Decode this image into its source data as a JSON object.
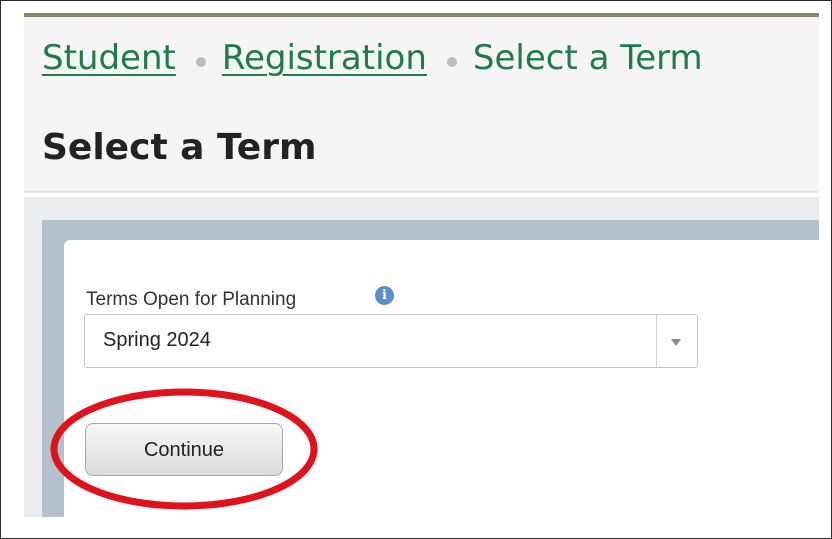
{
  "breadcrumb": {
    "items": [
      {
        "label": "Student"
      },
      {
        "label": "Registration"
      }
    ],
    "current": "Select a Term"
  },
  "page": {
    "title": "Select a Term"
  },
  "term_select": {
    "label": "Terms Open for Planning",
    "selected_value": "Spring 2024",
    "info_icon": "info-icon"
  },
  "actions": {
    "continue_label": "Continue"
  },
  "colors": {
    "link_green": "#1f7a4c",
    "annotation_red": "#e0121b",
    "panel_blue_gray": "#b4c1cc",
    "info_blue": "#5b8fc7"
  }
}
